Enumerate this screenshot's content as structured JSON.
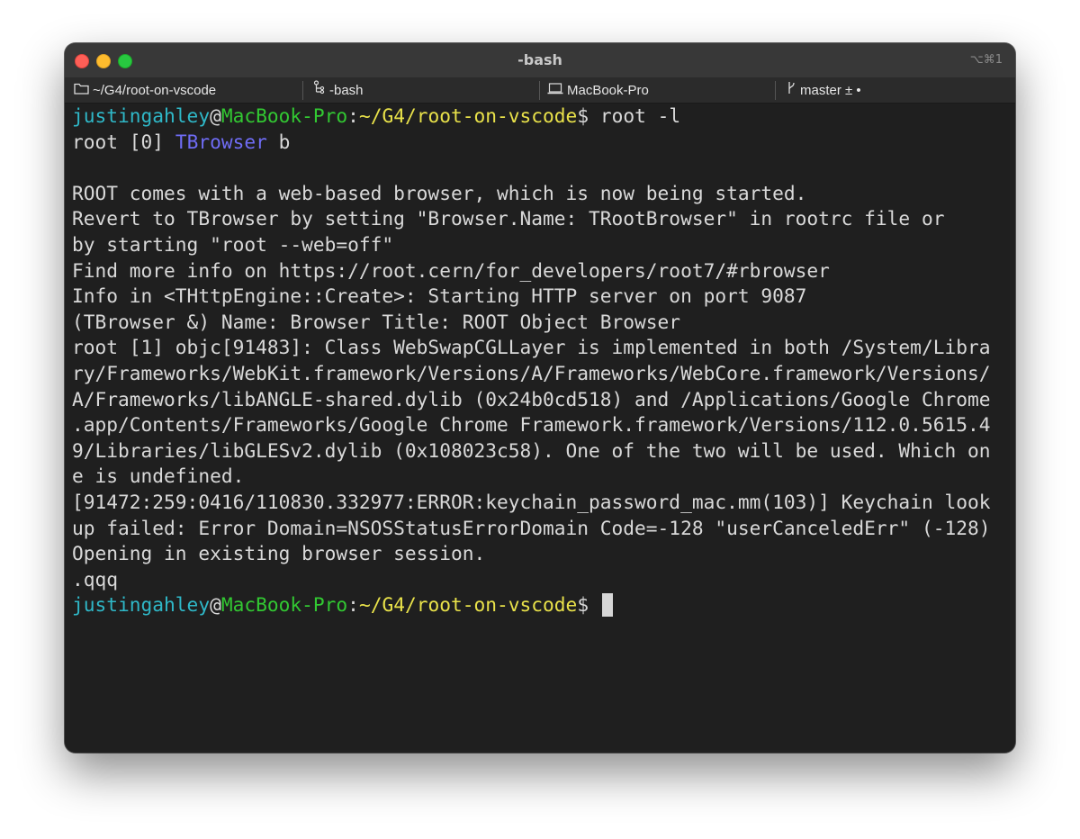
{
  "window": {
    "title": "-bash",
    "shortcut": "⌥⌘1"
  },
  "status": {
    "folder": "~/G4/root-on-vscode",
    "process": "-bash",
    "host": "MacBook-Pro",
    "branch": "master ± •"
  },
  "prompt": {
    "user": "justingahley",
    "at": "@",
    "host": "MacBook-Pro",
    "colon": ":",
    "path": "~/G4/root-on-vscode",
    "dollar": "$"
  },
  "command1": " root -l",
  "root0": {
    "prefix": "root [0] ",
    "cls": "TBrowser",
    "suffix": " b"
  },
  "output": [
    "",
    "ROOT comes with a web-based browser, which is now being started.",
    "Revert to TBrowser by setting \"Browser.Name: TRootBrowser\" in rootrc file or",
    "by starting \"root --web=off\"",
    "Find more info on https://root.cern/for_developers/root7/#rbrowser",
    "Info in <THttpEngine::Create>: Starting HTTP server on port 9087",
    "(TBrowser &) Name: Browser Title: ROOT Object Browser",
    "root [1] objc[91483]: Class WebSwapCGLLayer is implemented in both /System/Libra",
    "ry/Frameworks/WebKit.framework/Versions/A/Frameworks/WebCore.framework/Versions/",
    "A/Frameworks/libANGLE-shared.dylib (0x24b0cd518) and /Applications/Google Chrome",
    ".app/Contents/Frameworks/Google Chrome Framework.framework/Versions/112.0.5615.4",
    "9/Libraries/libGLESv2.dylib (0x108023c58). One of the two will be used. Which on",
    "e is undefined.",
    "[91472:259:0416/110830.332977:ERROR:keychain_password_mac.mm(103)] Keychain look",
    "up failed: Error Domain=NSOSStatusErrorDomain Code=-128 \"userCanceledErr\" (-128)",
    "Opening in existing browser session.",
    ".qqq"
  ],
  "final_command": " "
}
